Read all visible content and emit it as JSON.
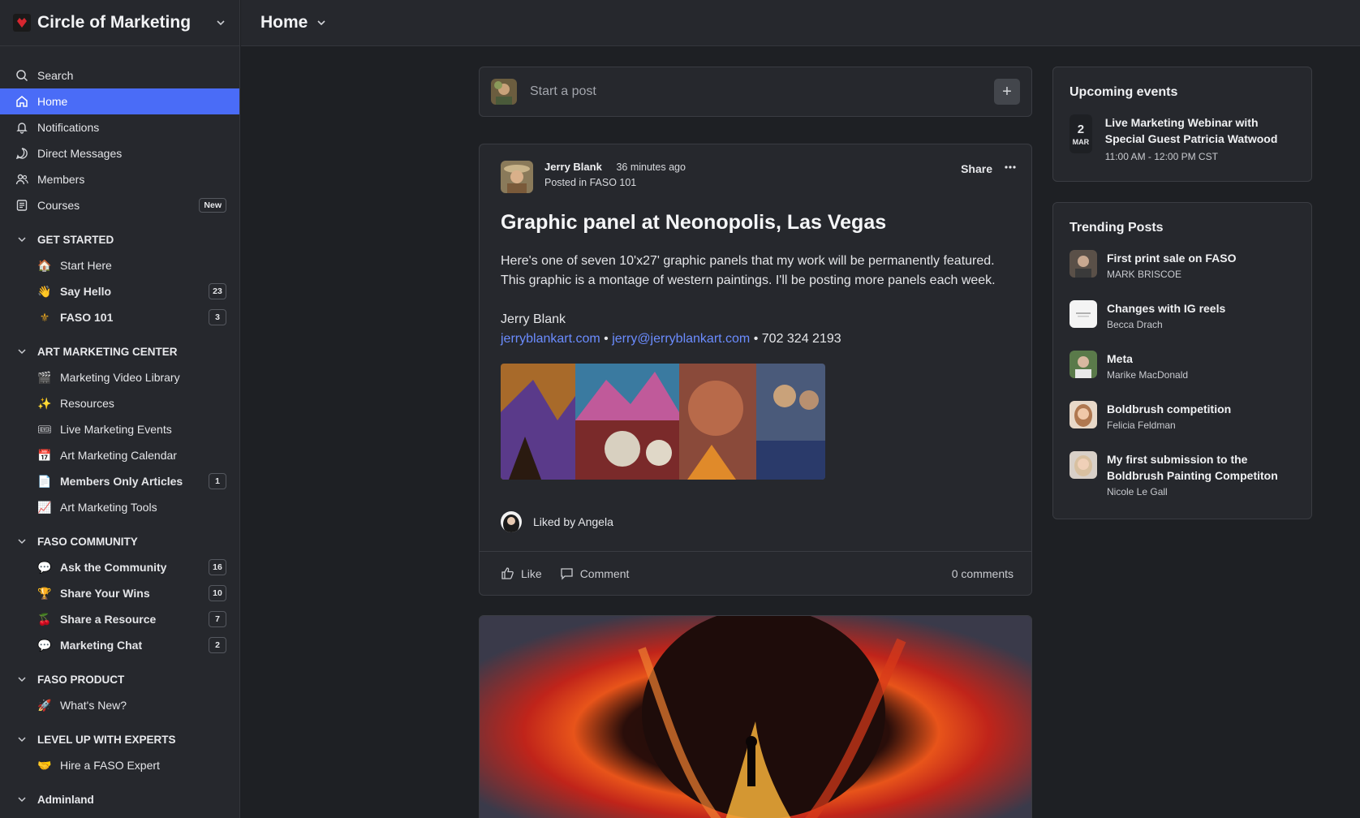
{
  "sidebar": {
    "brand": "Circle of Marketing",
    "nav": [
      {
        "label": "Search",
        "icon": "search-icon"
      },
      {
        "label": "Home",
        "icon": "home-icon",
        "active": true
      },
      {
        "label": "Notifications",
        "icon": "bell-icon"
      },
      {
        "label": "Direct Messages",
        "icon": "chat-icon"
      },
      {
        "label": "Members",
        "icon": "members-icon"
      },
      {
        "label": "Courses",
        "icon": "courses-icon",
        "badge": "New"
      }
    ],
    "sections": [
      {
        "title": "GET STARTED",
        "items": [
          {
            "label": "Start Here",
            "emoji": "🏠",
            "bold": false
          },
          {
            "label": "Say Hello",
            "emoji": "👋",
            "bold": true,
            "count": "23"
          },
          {
            "label": "FASO 101",
            "emoji": "⚜",
            "bold": true,
            "count": "3"
          }
        ]
      },
      {
        "title": "ART MARKETING CENTER",
        "items": [
          {
            "label": "Marketing Video Library",
            "emoji": "🎬"
          },
          {
            "label": "Resources",
            "emoji": "✨"
          },
          {
            "label": "Live Marketing Events",
            "emoji": "🎟"
          },
          {
            "label": "Art Marketing Calendar",
            "emoji": "📅"
          },
          {
            "label": "Members Only Articles",
            "emoji": "📄",
            "bold": true,
            "count": "1"
          },
          {
            "label": "Art Marketing Tools",
            "emoji": "📈"
          }
        ]
      },
      {
        "title": "FASO COMMUNITY",
        "items": [
          {
            "label": "Ask the Community",
            "emoji": "💬",
            "bold": true,
            "count": "16"
          },
          {
            "label": "Share Your Wins",
            "emoji": "🏆",
            "bold": true,
            "count": "10"
          },
          {
            "label": "Share a Resource",
            "emoji": "🍒",
            "bold": true,
            "count": "7"
          },
          {
            "label": "Marketing Chat",
            "emoji": "💬",
            "bold": true,
            "count": "2"
          }
        ]
      },
      {
        "title": "FASO PRODUCT",
        "items": [
          {
            "label": "What's New?",
            "emoji": "🚀"
          }
        ]
      },
      {
        "title": "LEVEL UP WITH EXPERTS",
        "items": [
          {
            "label": "Hire a FASO Expert",
            "emoji": "🤝"
          }
        ]
      },
      {
        "title": "Adminland",
        "items": []
      }
    ]
  },
  "topbar": {
    "title": "Home"
  },
  "composer": {
    "placeholder": "Start a post"
  },
  "post": {
    "author": "Jerry Blank",
    "time": "36 minutes ago",
    "posted_in": "Posted in FASO 101",
    "share": "Share",
    "title": "Graphic panel at Neonopolis, Las Vegas",
    "body": "Here's one of seven 10'x27' graphic panels that my work will be permanently featured. This graphic is a montage of western paintings. I'll be posting more panels each week.",
    "signature_name": "Jerry Blank",
    "link1": "jerryblankart.com",
    "link2": "jerry@jerryblankart.com",
    "phone": "702 324 2193",
    "liked_by": "Liked by Angela",
    "like": "Like",
    "comment": "Comment",
    "comments_count": "0 comments"
  },
  "events": {
    "title": "Upcoming events",
    "items": [
      {
        "day": "2",
        "month": "MAR",
        "title": "Live Marketing Webinar with Special Guest Patricia Watwood",
        "time": "11:00 AM - 12:00 PM CST"
      }
    ]
  },
  "trending": {
    "title": "Trending Posts",
    "items": [
      {
        "title": "First print sale on FASO",
        "author": "MARK BRISCOE"
      },
      {
        "title": "Changes with IG reels",
        "author": "Becca Drach"
      },
      {
        "title": "Meta",
        "author": "Marike MacDonald"
      },
      {
        "title": "Boldbrush competition",
        "author": "Felicia Feldman"
      },
      {
        "title": "My first submission to the Boldbrush Painting Competiton",
        "author": "Nicole Le Gall"
      }
    ]
  },
  "colors": {
    "accent": "#4a6cf7",
    "link": "#6b8cff",
    "background": "#1e2024",
    "panel": "#26282d"
  }
}
